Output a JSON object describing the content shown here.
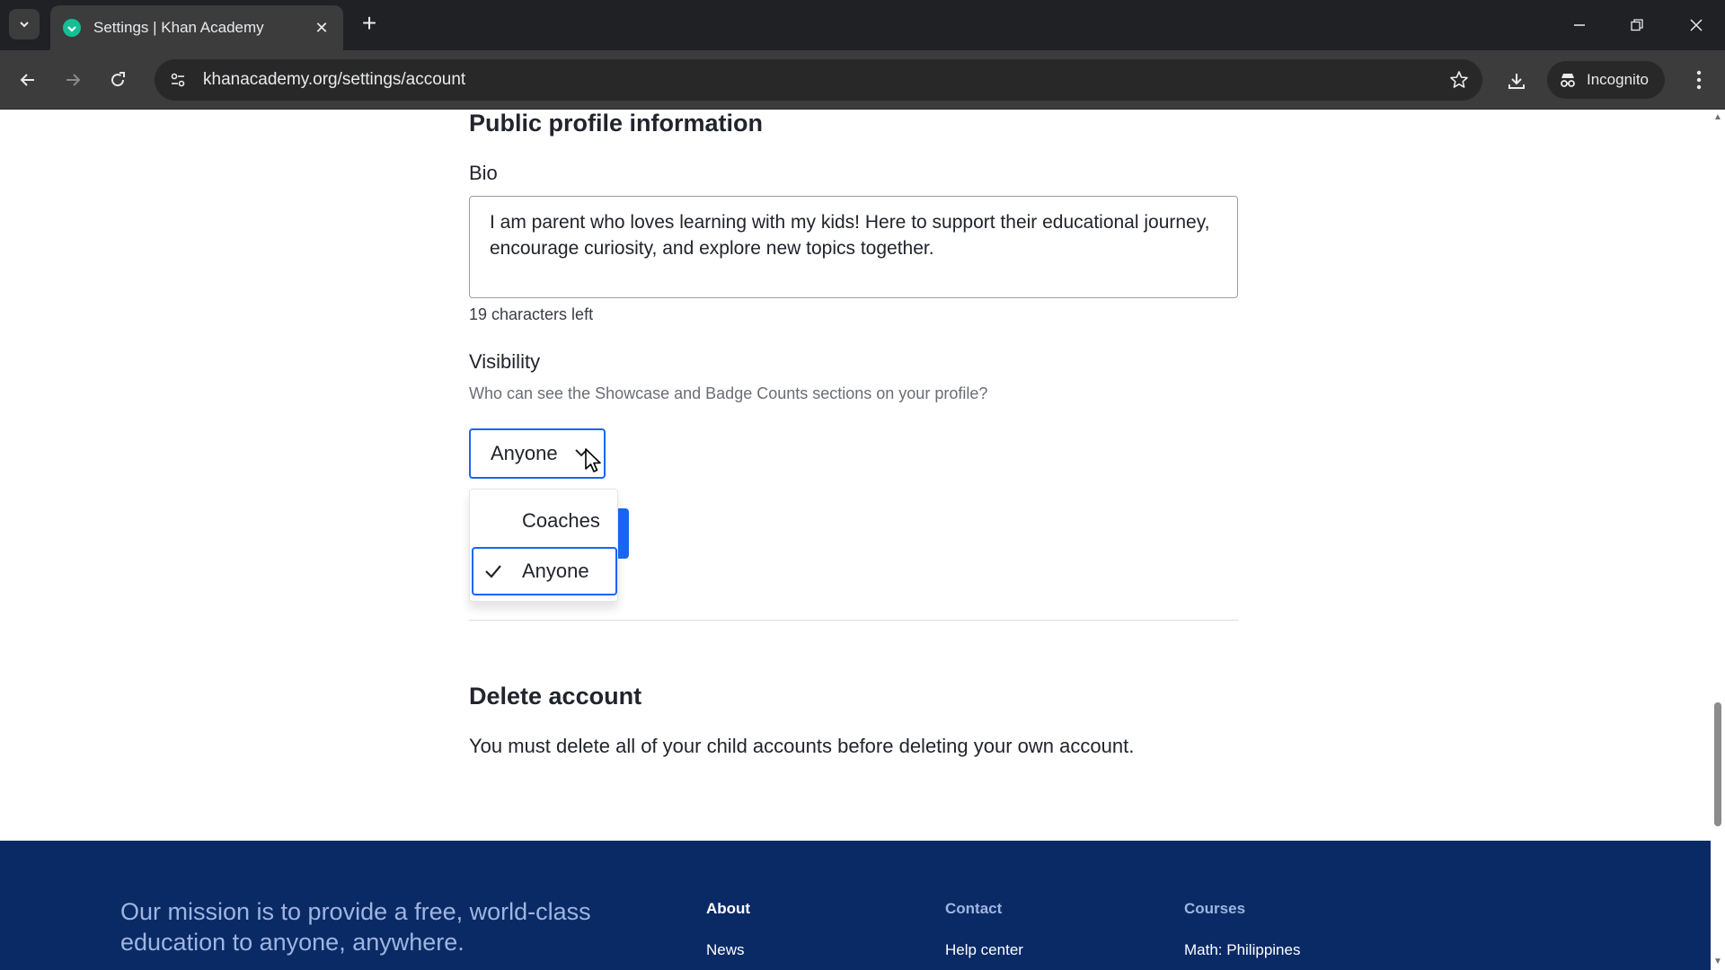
{
  "browser": {
    "tab_title": "Settings | Khan Academy",
    "url": "khanacademy.org/settings/account",
    "profile_label": "Incognito",
    "colors": {
      "frame": "#202124",
      "toolbar": "#3c3c3c",
      "favicon": "#14bf96"
    }
  },
  "page": {
    "public_profile": {
      "heading": "Public profile information",
      "bio_label": "Bio",
      "bio_value": "I am parent who loves learning with my kids! Here to support their educational journey, encourage curiosity, and explore new topics together.",
      "chars_left": "19 characters left"
    },
    "visibility": {
      "label": "Visibility",
      "help": "Who can see the Showcase and Badge Counts sections on your profile?",
      "selected": "Anyone",
      "options": [
        {
          "label": "Coaches",
          "selected": false
        },
        {
          "label": "Anyone",
          "selected": true
        }
      ]
    },
    "delete_account": {
      "heading": "Delete account",
      "text": "You must delete all of your child accounts before deleting your own account."
    },
    "accent_color": "#1865f2"
  },
  "footer": {
    "mission": "Our mission is to provide a free, world-class education to anyone, anywhere.",
    "columns": [
      {
        "heading": "About",
        "link": "News"
      },
      {
        "heading": "Contact",
        "link": "Help center"
      },
      {
        "heading": "Courses",
        "link": "Math: Philippines"
      }
    ],
    "background_color": "#0a2a66"
  }
}
